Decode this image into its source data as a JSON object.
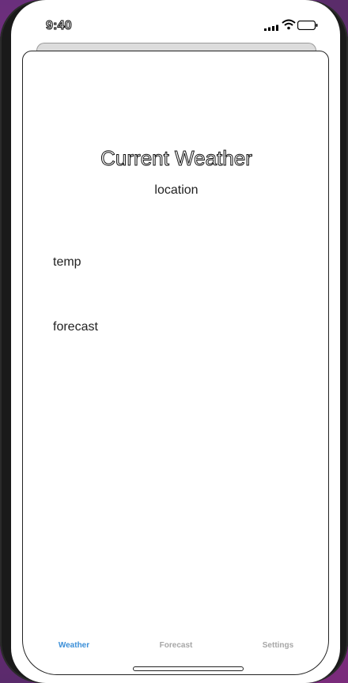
{
  "status_bar": {
    "time": "9:40",
    "icons": [
      "signal-icon",
      "wifi-icon",
      "battery-icon"
    ]
  },
  "main": {
    "title": "Current Weather",
    "location": "location",
    "temp": "temp",
    "forecast": "forecast"
  },
  "tabs": [
    {
      "label": "Weather",
      "active": true
    },
    {
      "label": "Forecast",
      "active": false
    },
    {
      "label": "Settings",
      "active": false
    }
  ],
  "colors": {
    "accent": "#3b8fd8",
    "inactive_tab": "#a6a6a6"
  }
}
